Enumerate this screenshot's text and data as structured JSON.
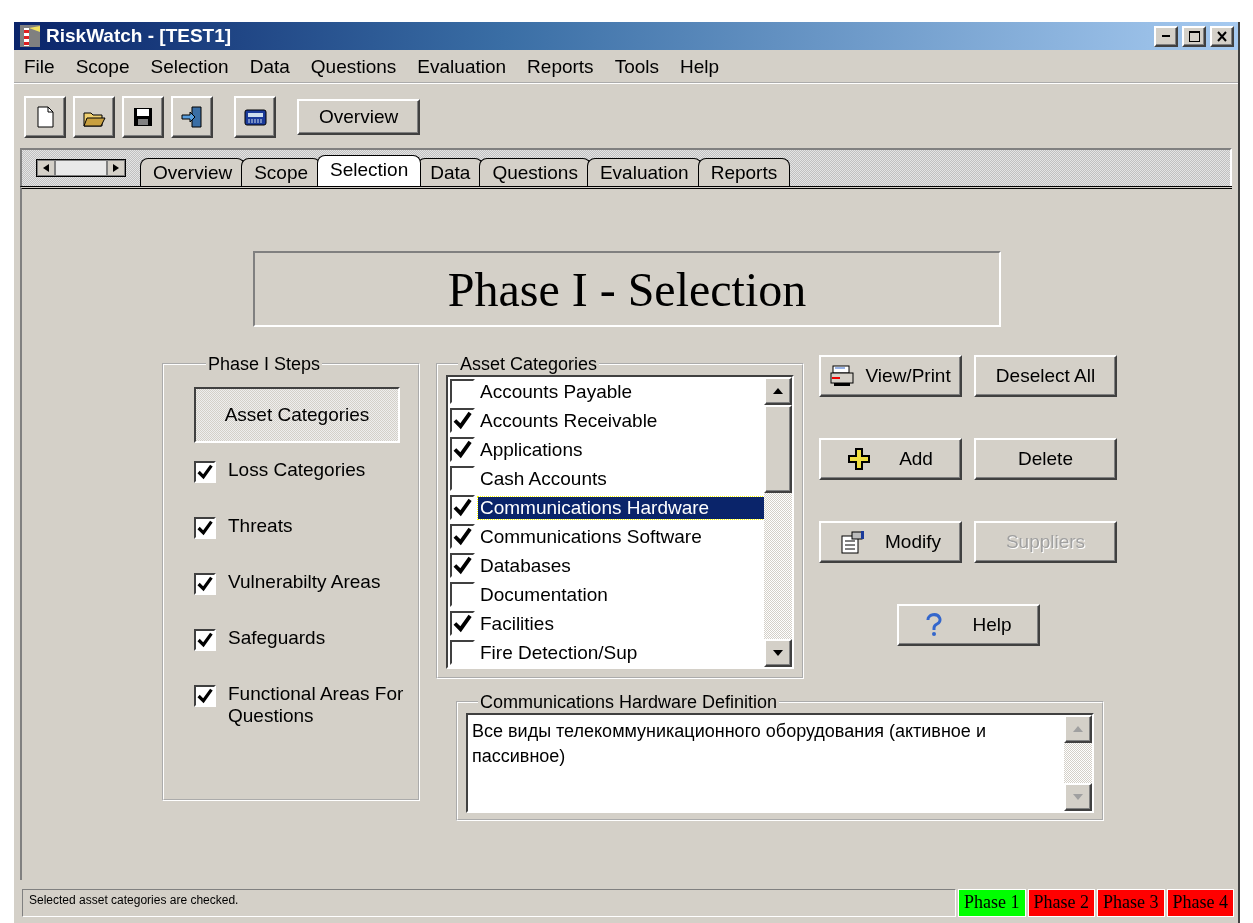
{
  "window": {
    "title": "RiskWatch - [TEST1]"
  },
  "menu": [
    {
      "label": "File"
    },
    {
      "label": "Scope"
    },
    {
      "label": "Selection"
    },
    {
      "label": "Data"
    },
    {
      "label": "Questions"
    },
    {
      "label": "Evaluation"
    },
    {
      "label": "Reports"
    },
    {
      "label": "Tools"
    },
    {
      "label": "Help"
    }
  ],
  "toolbar": {
    "tools": [
      {
        "kind": "new"
      },
      {
        "kind": "open"
      },
      {
        "kind": "save"
      },
      {
        "kind": "exit"
      },
      {
        "kind": "calculator"
      }
    ],
    "overview_button": "Overview"
  },
  "tabs": [
    {
      "label": "Overview",
      "selected": false
    },
    {
      "label": "Scope",
      "selected": false
    },
    {
      "label": "Selection",
      "selected": true
    },
    {
      "label": "Data",
      "selected": false
    },
    {
      "label": "Questions",
      "selected": false
    },
    {
      "label": "Evaluation",
      "selected": false
    },
    {
      "label": "Reports",
      "selected": false
    }
  ],
  "heading": "Phase I - Selection",
  "phase_steps": {
    "legend": "Phase I Steps",
    "current_step": "Asset Categories",
    "steps": [
      {
        "label": "Loss Categories",
        "checked": true
      },
      {
        "label": "Threats",
        "checked": true
      },
      {
        "label": "Vulnerabilty Areas",
        "checked": true
      },
      {
        "label": "Safeguards",
        "checked": true
      },
      {
        "label": "Functional Areas For Questions",
        "checked": true
      }
    ]
  },
  "asset_categories": {
    "legend": "Asset Categories",
    "items": [
      {
        "label": "Accounts Payable",
        "checked": false,
        "selected": false
      },
      {
        "label": "Accounts Receivable",
        "checked": true,
        "selected": false
      },
      {
        "label": "Applications",
        "checked": true,
        "selected": false
      },
      {
        "label": "Cash Accounts",
        "checked": false,
        "selected": false
      },
      {
        "label": "Communications Hardware",
        "checked": true,
        "selected": true
      },
      {
        "label": "Communications Software",
        "checked": true,
        "selected": false
      },
      {
        "label": "Databases",
        "checked": true,
        "selected": false
      },
      {
        "label": "Documentation",
        "checked": false,
        "selected": false
      },
      {
        "label": "Facilities",
        "checked": true,
        "selected": false
      },
      {
        "label": "Fire Detection/Sup",
        "checked": false,
        "selected": false
      }
    ]
  },
  "buttons": [
    {
      "label": "View/Print",
      "disabled": false
    },
    {
      "label": "Deselect All",
      "disabled": false
    },
    {
      "label": "Add",
      "disabled": false
    },
    {
      "label": "Delete",
      "disabled": false
    },
    {
      "label": "Modify",
      "disabled": false
    },
    {
      "label": "Suppliers",
      "disabled": true
    }
  ],
  "help_button": "Help",
  "definition": {
    "legend": "Communications Hardware Definition",
    "value": "Все виды телекоммуникационного оборудования (активное и пассивное)"
  },
  "status_bar": {
    "message": "Selected asset categories are checked.",
    "phases": [
      {
        "label": "Phase 1",
        "color": "#00ff00"
      },
      {
        "label": "Phase 2",
        "color": "#ff0000"
      },
      {
        "label": "Phase 3",
        "color": "#ff0000"
      },
      {
        "label": "Phase 4",
        "color": "#ff0000"
      }
    ]
  }
}
